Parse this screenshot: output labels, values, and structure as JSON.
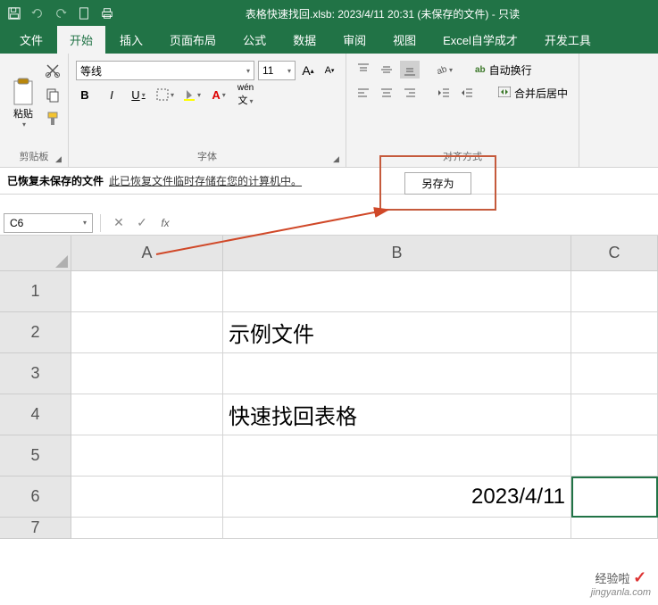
{
  "title": "表格快速找回.xlsb: 2023/4/11 20:31 (未保存的文件)  -  只读",
  "tabs": [
    "文件",
    "开始",
    "插入",
    "页面布局",
    "公式",
    "数据",
    "审阅",
    "视图",
    "Excel自学成才",
    "开发工具"
  ],
  "active_tab": 1,
  "clipboard": {
    "paste": "粘贴",
    "group": "剪贴板"
  },
  "font": {
    "name": "等线",
    "size": "11",
    "bold": "B",
    "italic": "I",
    "underline": "U",
    "wen": "wén",
    "group": "字体"
  },
  "align": {
    "wrap": "自动换行",
    "merge": "合并后居中",
    "ab_label": "ab",
    "group": "对齐方式"
  },
  "recovery": {
    "title": "已恢复未保存的文件",
    "msg": "此已恢复文件临时存储在您的计算机中。",
    "save_as": "另存为"
  },
  "namebox": "C6",
  "fx": "fx",
  "columns": [
    "A",
    "B",
    "C"
  ],
  "rows": [
    {
      "n": "1",
      "A": "",
      "B": "",
      "C": ""
    },
    {
      "n": "2",
      "A": "",
      "B": "示例文件",
      "C": ""
    },
    {
      "n": "3",
      "A": "",
      "B": "",
      "C": ""
    },
    {
      "n": "4",
      "A": "",
      "B": "快速找回表格",
      "C": ""
    },
    {
      "n": "5",
      "A": "",
      "B": "",
      "C": ""
    },
    {
      "n": "6",
      "A": "",
      "B": "2023/4/11",
      "C": ""
    },
    {
      "n": "7",
      "A": "",
      "B": "",
      "C": ""
    }
  ],
  "watermark": {
    "brand": "经验啦",
    "url": "jingyanla.com"
  }
}
